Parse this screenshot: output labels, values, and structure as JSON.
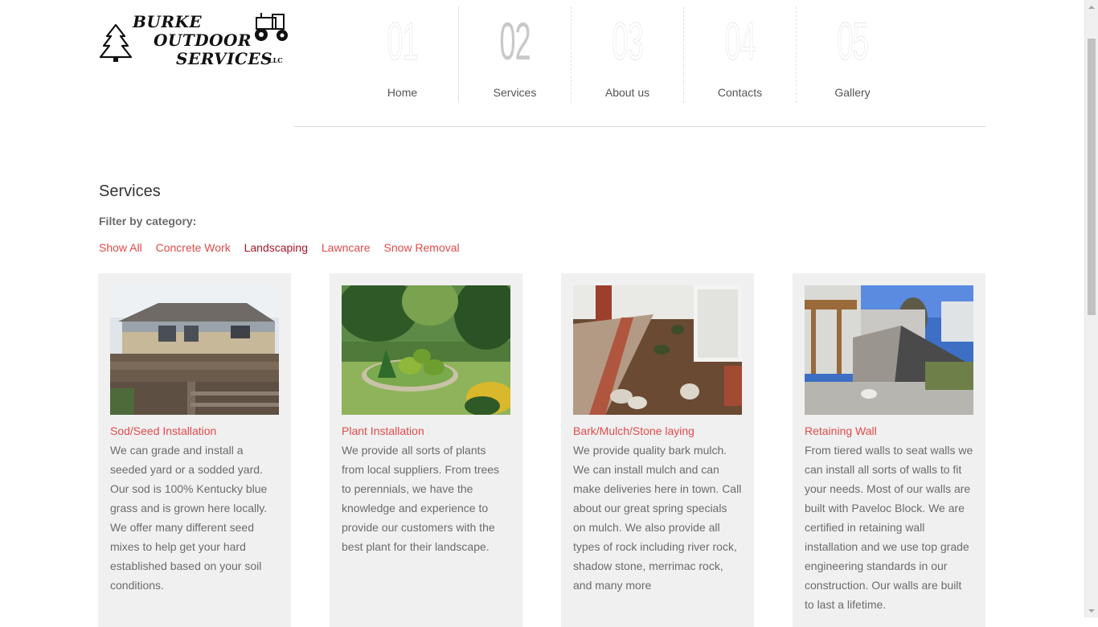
{
  "logo": {
    "line1": "BURKE",
    "line2": "OUTDOOR",
    "line3": "SERVICES",
    "suffix": "LLC"
  },
  "nav": [
    {
      "num": "01",
      "label": "Home"
    },
    {
      "num": "02",
      "label": "Services"
    },
    {
      "num": "03",
      "label": "About us"
    },
    {
      "num": "04",
      "label": "Contacts"
    },
    {
      "num": "05",
      "label": "Gallery"
    }
  ],
  "page_title": "Services",
  "filter_label": "Filter by category:",
  "filters": [
    "Show All",
    "Concrete Work",
    "Landscaping",
    "Lawncare",
    "Snow Removal"
  ],
  "selected_filter": "Landscaping",
  "cards": [
    {
      "title": "Sod/Seed Installation",
      "desc": "We can grade and install a seeded yard or a sodded yard. Our sod is 100% Kentucky blue grass and is grown here locally. We offer many different seed mixes to help get your hard established based on your soil conditions."
    },
    {
      "title": "Plant Installation",
      "desc": "We provide all sorts of plants from local suppliers.  From trees to perennials, we have the knowledge and experience to provide our customers with the best plant for their landscape."
    },
    {
      "title": "Bark/Mulch/Stone laying",
      "desc": "We provide quality bark mulch. We can install mulch and can make deliveries here in town. Call about our great spring specials on mulch. We also provide all types of rock including river rock, shadow stone, merrimac rock, and many more"
    },
    {
      "title": "Retaining Wall",
      "desc": "From tiered walls to seat walls we can install all sorts of walls to fit your needs.  Most of our walls are built with Paveloc Block.  We are certified in retaining wall installation and we use top grade engineering standards in our construction.  Our walls are built to last a lifetime."
    }
  ],
  "colors": {
    "accent": "#e14b4b",
    "selected": "#a8162a",
    "card_bg": "#f0f0f0"
  }
}
